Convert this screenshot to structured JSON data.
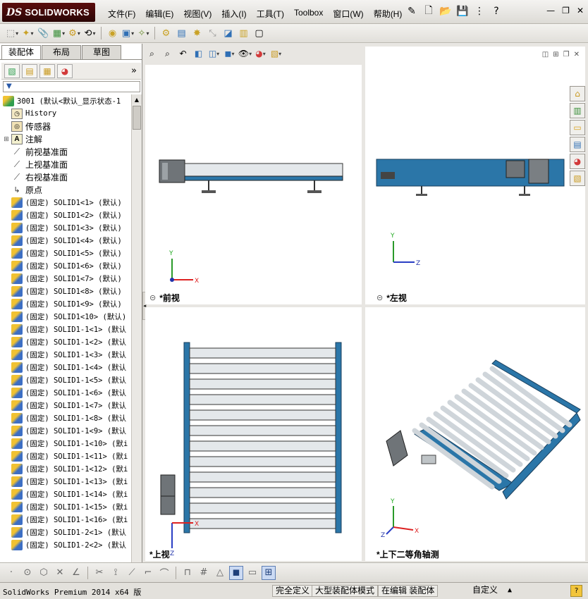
{
  "app": {
    "logo_ds": "DS",
    "logo_text": "SOLIDWORKS"
  },
  "menu": [
    "文件(F)",
    "编辑(E)",
    "视图(V)",
    "插入(I)",
    "工具(T)",
    "Toolbox",
    "窗口(W)",
    "帮助(H)"
  ],
  "feature_tabs": [
    "装配体",
    "布局",
    "草图"
  ],
  "tree": {
    "root_label": "3001  (默认<默认_显示状态-1",
    "items": [
      {
        "label": "History",
        "icon": "history-icon"
      },
      {
        "label": "传感器",
        "icon": "sensor-icon"
      },
      {
        "label": "注解",
        "icon": "annotation-icon",
        "expandable": true
      },
      {
        "label": "前视基准面",
        "icon": "plane-icon"
      },
      {
        "label": "上视基准面",
        "icon": "plane-icon"
      },
      {
        "label": "右视基准面",
        "icon": "plane-icon"
      },
      {
        "label": "原点",
        "icon": "origin-icon"
      }
    ],
    "parts": [
      "(固定) SOLID1<1> (默认)",
      "(固定) SOLID1<2> (默认)",
      "(固定) SOLID1<3> (默认)",
      "(固定) SOLID1<4> (默认)",
      "(固定) SOLID1<5> (默认)",
      "(固定) SOLID1<6> (默认)",
      "(固定) SOLID1<7> (默认)",
      "(固定) SOLID1<8> (默认)",
      "(固定) SOLID1<9> (默认)",
      "(固定) SOLID1<10> (默认)",
      "(固定) SOLID1-1<1> (默认",
      "(固定) SOLID1-1<2> (默认",
      "(固定) SOLID1-1<3> (默认",
      "(固定) SOLID1-1<4> (默认",
      "(固定) SOLID1-1<5> (默认",
      "(固定) SOLID1-1<6> (默认",
      "(固定) SOLID1-1<7> (默认",
      "(固定) SOLID1-1<8> (默认",
      "(固定) SOLID1-1<9> (默认",
      "(固定) SOLID1-1<10> (默i",
      "(固定) SOLID1-1<11> (默i",
      "(固定) SOLID1-1<12> (默i",
      "(固定) SOLID1-1<13> (默i",
      "(固定) SOLID1-1<14> (默i",
      "(固定) SOLID1-1<15> (默i",
      "(固定) SOLID1-1<16> (默i",
      "(固定) SOLID1-2<1> (默认",
      "(固定) SOLID1-2<2> (默认"
    ]
  },
  "views": {
    "front": "*前视",
    "left": "*左视",
    "top": "*上视",
    "iso": "*上下二等角轴测"
  },
  "axes": {
    "x": "X",
    "y": "Y",
    "z": "Z"
  },
  "status": {
    "product": "SolidWorks Premium 2014 x64 版",
    "fully_defined": "完全定义",
    "large_asm": "大型装配体模式",
    "editing": "在编辑 装配体",
    "units": "自定义"
  },
  "colors": {
    "frame_blue": "#2b76a8",
    "roller_gray": "#d7dde2",
    "motor_dark": "#6f7478",
    "accent_red": "#5b0d0d"
  }
}
